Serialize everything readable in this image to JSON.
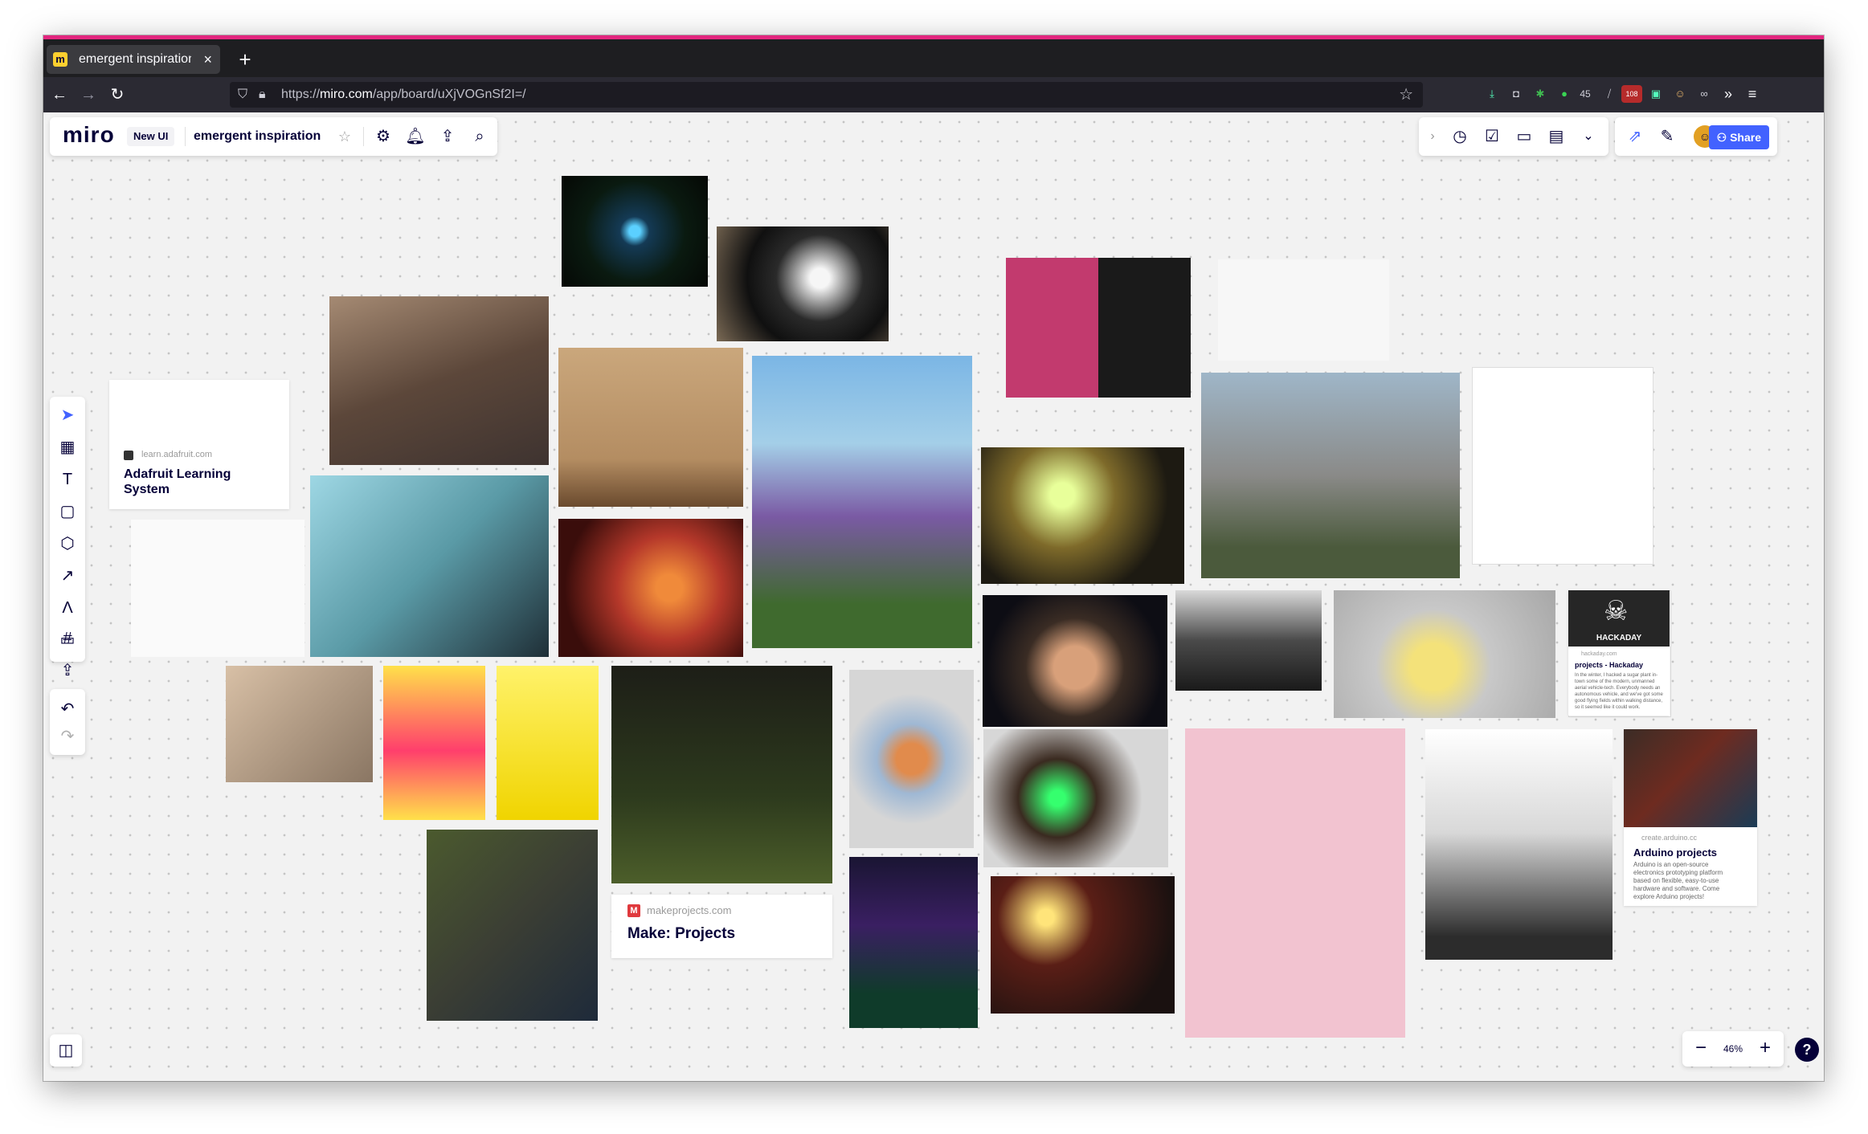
{
  "browser": {
    "tab_title": "emergent inspiration, On",
    "tab_close": "×",
    "new_tab": "+",
    "url_prefix": "https://",
    "url_host": "miro.com",
    "url_path": "/app/board/uXjVOGnSf2I=/",
    "toolbar_badges": {
      "notifications_count": "45",
      "extension_count": "108"
    }
  },
  "board": {
    "logo": "miro",
    "new_ui_badge": "New UI",
    "name": "emergent inspiration",
    "share_label": "Share",
    "zoom": "46%"
  },
  "cards": {
    "adafruit": {
      "domain": "learn.adafruit.com",
      "title": "Adafruit Learning System"
    },
    "make": {
      "domain": "makeprojects.com",
      "title": "Make: Projects",
      "favicon": "M"
    },
    "hackaday": {
      "image_label": "HACKADAY",
      "domain": "hackaday.com",
      "title": "projects - Hackaday",
      "desc": "In the winter, I hacked a sugar plant in-town some of the modern, unmanned aerial vehicle-tech. Everybody needs an autonomous vehicle, and we've got some good flying fields within walking distance, so it seemed like it could work."
    },
    "arduino": {
      "domain": "create.arduino.cc",
      "title": "Arduino projects",
      "desc": "Arduino is an open-source electronics prototyping platform based on flexible, easy-to-use hardware and software. Come explore Arduino projects!"
    }
  },
  "colors": {
    "brand": "#050038",
    "accent": "#4262ff",
    "tab_accent": "#e3267f",
    "browser_bg": "#2b2a33"
  },
  "icons": {
    "settings": "gear-icon",
    "notifications": "bell-icon",
    "export": "upload-icon",
    "search": "search-icon",
    "timer": "timer-icon",
    "present": "present-icon",
    "notes": "notes-icon"
  }
}
